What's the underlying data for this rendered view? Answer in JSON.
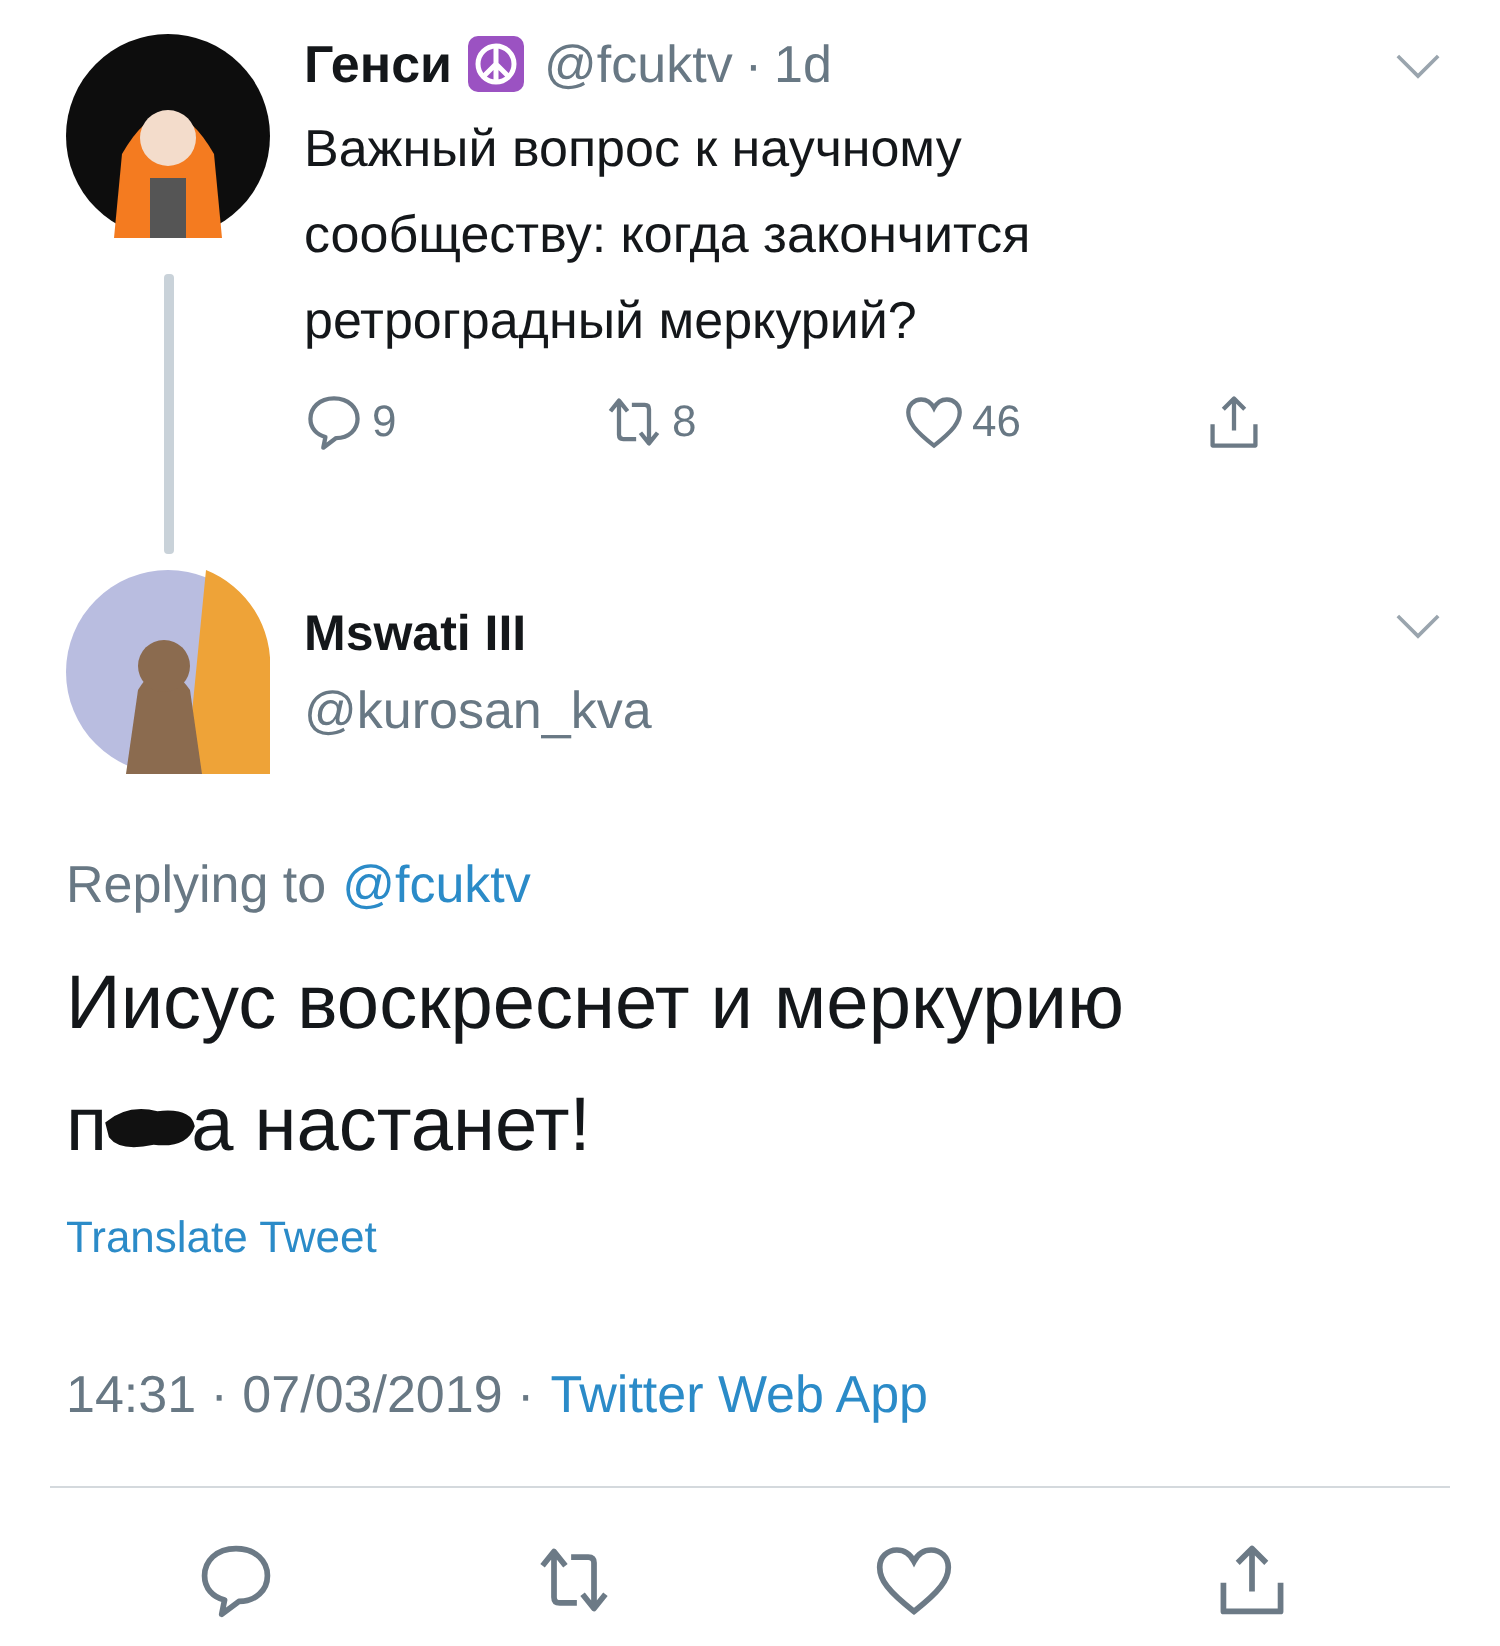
{
  "parent_tweet": {
    "name": "Генси",
    "handle": "@fcuktv",
    "separator": "·",
    "time": "1d",
    "text": "Важный вопрос к научному сообществу: когда закончится ретроградный меркурий?",
    "actions": [
      {
        "kind": "reply",
        "count": "9"
      },
      {
        "kind": "retweet",
        "count": "8"
      },
      {
        "kind": "like",
        "count": "46"
      },
      {
        "kind": "share"
      }
    ]
  },
  "tweet": {
    "name": "Mswati III",
    "handle": "@kurosan_kva",
    "replying_label": "Replying to",
    "replying_to": "@fcuktv",
    "body": {
      "line_1": "Иисус воскреснет и меркурию",
      "line_2_before": "п",
      "redacted": true,
      "line_2_after": "а настанет!"
    },
    "translate": "Translate Tweet",
    "timestamp": "14:31 · 07/03/2019 ·",
    "source": "Twitter Web App",
    "actions": [
      {
        "kind": "reply"
      },
      {
        "kind": "retweet"
      },
      {
        "kind": "like"
      },
      {
        "kind": "share"
      }
    ]
  }
}
